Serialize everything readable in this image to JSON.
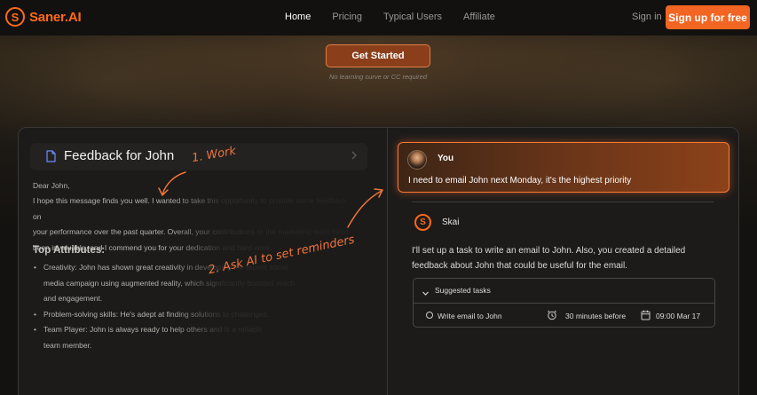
{
  "nav": {
    "logo_text": "Saner.AI",
    "logo_letter": "S",
    "links": [
      "Home",
      "Pricing",
      "Typical Users",
      "Affiliate"
    ],
    "signin": "Sign in",
    "signup": "Sign up for free"
  },
  "hero": {
    "cta": "Get Started",
    "note": "No learning curve or CC required"
  },
  "document": {
    "title": "Feedback for John",
    "greeting": "Dear John,",
    "para_lines": [
      "I hope this message finds you well. I wanted to take this opportunity to provide some feedback on",
      "your performance over the past quarter. Overall, your contributions to the marketing team have",
      "been invaluable, and I commend you for your dedication and hard work."
    ],
    "attributes_heading": "Top Attributes:",
    "attributes": [
      {
        "lines": [
          "Creativity: John has shown great creativity in developing the recent social",
          "media campaign using augmented reality, which significantly boosted reach",
          "and engagement."
        ]
      },
      {
        "lines": [
          "Problem-solving skills: He's adept at finding solutions to challenges."
        ]
      },
      {
        "lines": [
          "Team Player: John is always ready to help others and is a reliable",
          "team member."
        ]
      }
    ]
  },
  "chat": {
    "user": {
      "name": "You",
      "message": "I need to email John next Monday, it's the highest priority"
    },
    "assistant": {
      "logo_letter": "S",
      "name": "Skai",
      "message": "I'll set up a task to write an email to John. Also, you created a detailed feedback about John that could be useful for the email."
    },
    "suggested": {
      "title": "Suggested tasks",
      "task": {
        "label": "Write email to John",
        "reminder": "30 minutes before",
        "date": "09:00 Mar 17"
      }
    }
  },
  "annotations": {
    "work": "1. Work",
    "ask_ai": "2. Ask AI to set reminders"
  },
  "colors": {
    "accent": "#f26522",
    "panel": "#1c1b1a",
    "background": "#141210"
  },
  "icons": [
    "document-icon",
    "chevron-right-icon",
    "chevron-down-icon",
    "circle-check-icon",
    "alarm-clock-icon",
    "calendar-icon"
  ]
}
